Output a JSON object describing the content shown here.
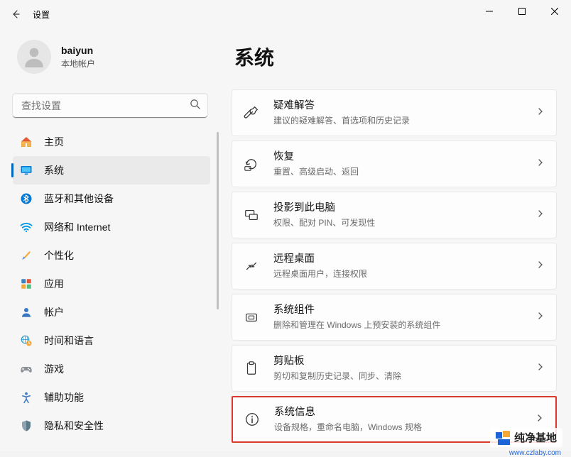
{
  "titlebar": {
    "app_name": "设置"
  },
  "profile": {
    "name": "baiyun",
    "sub": "本地帐户"
  },
  "search": {
    "placeholder": "查找设置"
  },
  "nav": [
    {
      "label": "主页"
    },
    {
      "label": "系统",
      "selected": true
    },
    {
      "label": "蓝牙和其他设备"
    },
    {
      "label": "网络和 Internet"
    },
    {
      "label": "个性化"
    },
    {
      "label": "应用"
    },
    {
      "label": "帐户"
    },
    {
      "label": "时间和语言"
    },
    {
      "label": "游戏"
    },
    {
      "label": "辅助功能"
    },
    {
      "label": "隐私和安全性"
    }
  ],
  "page": {
    "title": "系统"
  },
  "cards": [
    {
      "title": "疑难解答",
      "sub": "建议的疑难解答、首选项和历史记录"
    },
    {
      "title": "恢复",
      "sub": "重置、高级启动、返回"
    },
    {
      "title": "投影到此电脑",
      "sub": "权限、配对 PIN、可发现性"
    },
    {
      "title": "远程桌面",
      "sub": "远程桌面用户，连接权限"
    },
    {
      "title": "系统组件",
      "sub": "删除和管理在 Windows 上预安装的系统组件"
    },
    {
      "title": "剪贴板",
      "sub": "剪切和复制历史记录、同步、清除"
    },
    {
      "title": "系统信息",
      "sub": "设备规格，重命名电脑，Windows 规格",
      "highlight": true
    }
  ],
  "watermark": {
    "text": "纯净基地",
    "url": "www.czlaby.com"
  }
}
